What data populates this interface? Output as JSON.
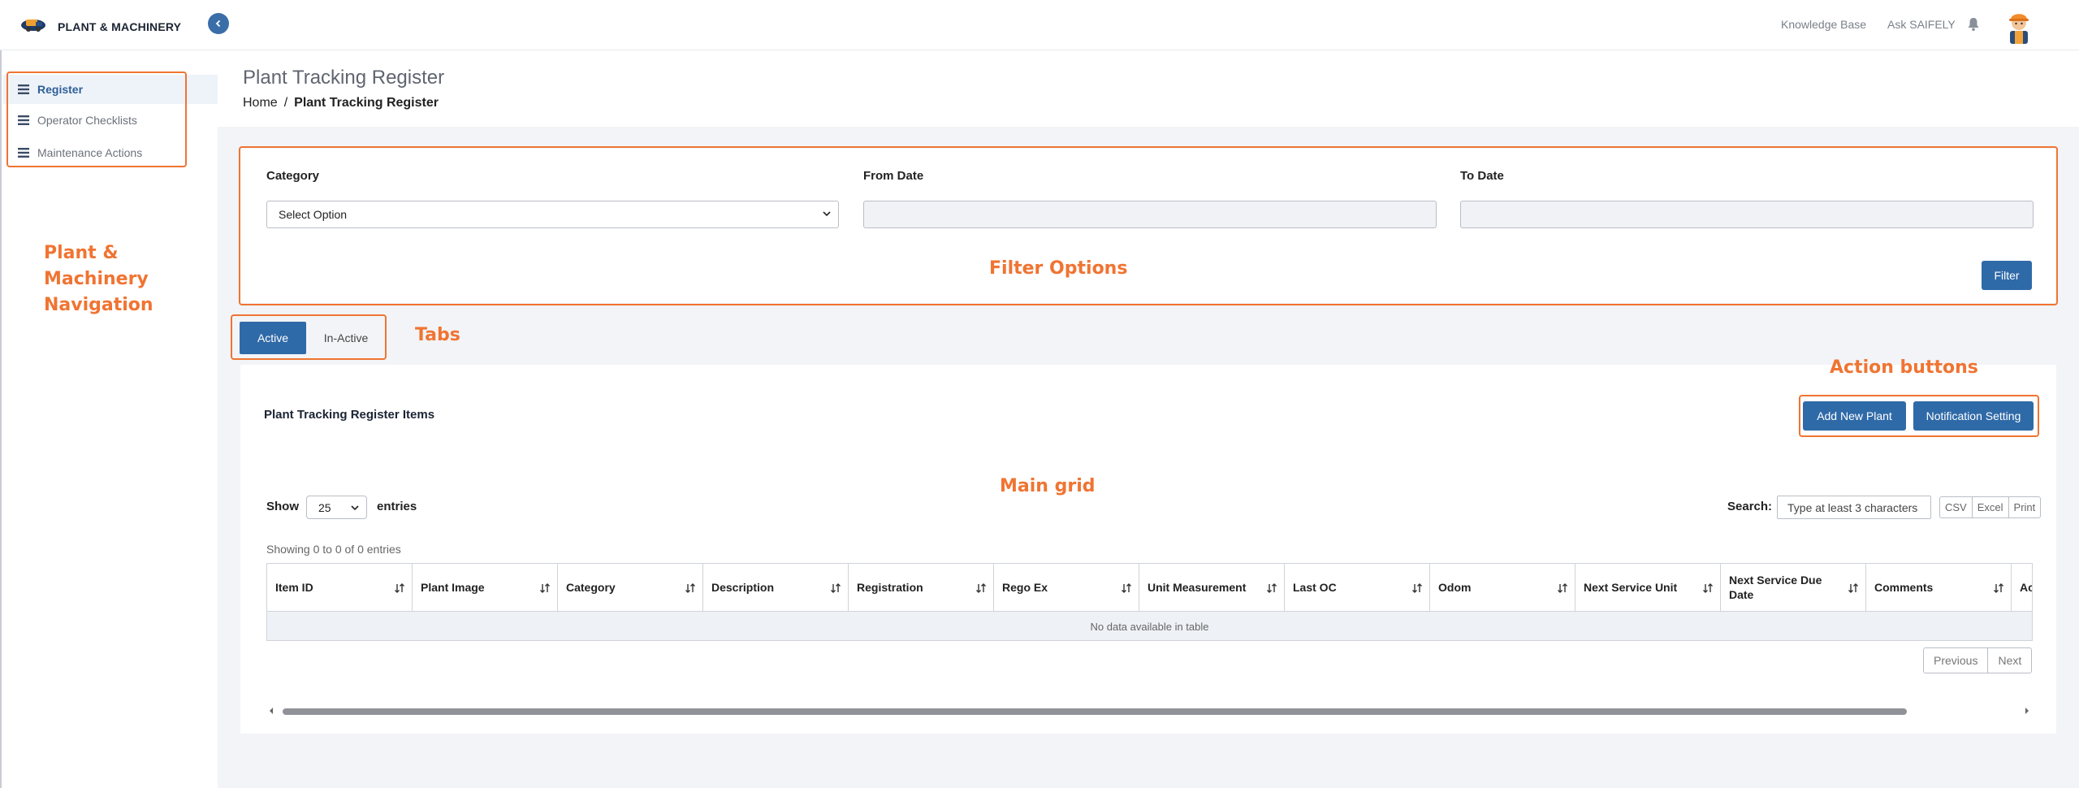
{
  "app": {
    "title": "PLANT & MACHINERY",
    "logo_icon": "plant-machinery-logo-icon",
    "collapse_icon": "chevron-left-icon"
  },
  "topnav": {
    "knowledge_base": "Knowledge Base",
    "ask": "Ask SAIFELY",
    "bell_icon": "bell-icon",
    "avatar_icon": "user-avatar-icon"
  },
  "sidebar": {
    "items": [
      {
        "label": "Register",
        "icon": "list-icon",
        "active": true
      },
      {
        "label": "Operator Checklists",
        "icon": "list-icon",
        "active": false
      },
      {
        "label": "Maintenance Actions",
        "icon": "list-icon",
        "active": false
      }
    ]
  },
  "header": {
    "title": "Plant Tracking Register",
    "breadcrumb_home": "Home",
    "breadcrumb_sep": "/",
    "breadcrumb_current": "Plant Tracking Register"
  },
  "filters": {
    "category_label": "Category",
    "category_value": "Select Option",
    "from_date_label": "From Date",
    "from_date_value": "",
    "to_date_label": "To Date",
    "to_date_value": "",
    "filter_button": "Filter"
  },
  "tabs": {
    "active": "Active",
    "inactive": "In-Active"
  },
  "grid": {
    "panel_title": "Plant Tracking Register Items",
    "add_button": "Add New Plant",
    "notification_button": "Notification Setting",
    "show_label": "Show",
    "entries_value": "25",
    "entries_label": "entries",
    "search_label": "Search:",
    "search_placeholder": "Type at least 3 characters",
    "export": [
      "CSV",
      "Excel",
      "Print"
    ],
    "info": "Showing 0 to 0 of 0 entries",
    "columns": [
      "Item ID",
      "Plant Image",
      "Category",
      "Description",
      "Registration",
      "Rego Ex",
      "Unit Measurement",
      "Last OC",
      "Odom",
      "Next Service Unit",
      "Next Service Due Date",
      "Comments",
      "Acti"
    ],
    "empty_message": "No data available in table",
    "prev": "Previous",
    "next": "Next"
  },
  "annotations": {
    "nav": "Plant & Machinery Navigation",
    "filter": "Filter Options",
    "tabs": "Tabs",
    "actions": "Action buttons",
    "grid": "Main grid",
    "color": "#f07432"
  },
  "colors": {
    "primary": "#2f6aa8",
    "background": "#f2f4f7"
  }
}
